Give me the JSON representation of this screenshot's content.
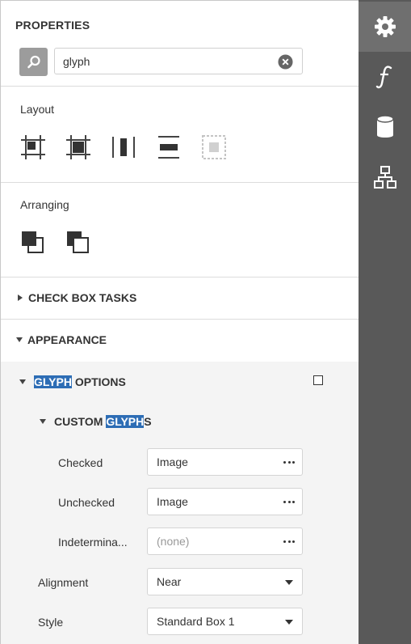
{
  "panel": {
    "title": "PROPERTIES",
    "search": {
      "value": "glyph"
    }
  },
  "layout": {
    "label": "Layout",
    "tools": [
      "align-to-grid-icon",
      "size-to-grid-icon",
      "center-horizontally-icon",
      "center-vertically-icon",
      "fit-bounds-icon"
    ]
  },
  "arranging": {
    "label": "Arranging",
    "tools": [
      "bring-to-front-icon",
      "send-to-back-icon"
    ]
  },
  "groups": {
    "check_box_tasks": "CHECK BOX TASKS",
    "appearance": "APPEARANCE",
    "glyph_options": {
      "highlight": "GLYPH",
      "rest": " OPTIONS"
    },
    "custom_glyphs": {
      "prefix": "CUSTOM ",
      "highlight": "GLYPH",
      "suffix": "S"
    }
  },
  "properties": {
    "checked": {
      "label": "Checked",
      "value": "Image"
    },
    "unchecked": {
      "label": "Unchecked",
      "value": "Image"
    },
    "indeterminate": {
      "label": "Indetermina...",
      "value": "(none)"
    },
    "alignment": {
      "label": "Alignment",
      "value": "Near"
    },
    "style": {
      "label": "Style",
      "value": "Standard Box 1"
    }
  },
  "sidebar_tabs": [
    "gear-icon",
    "function-icon",
    "database-icon",
    "hierarchy-icon"
  ],
  "colors": {
    "highlight": "#2d6db5",
    "sidebar": "#595959",
    "sidebar_active": "#6f6f6f",
    "group_bg": "#f4f4f4"
  }
}
